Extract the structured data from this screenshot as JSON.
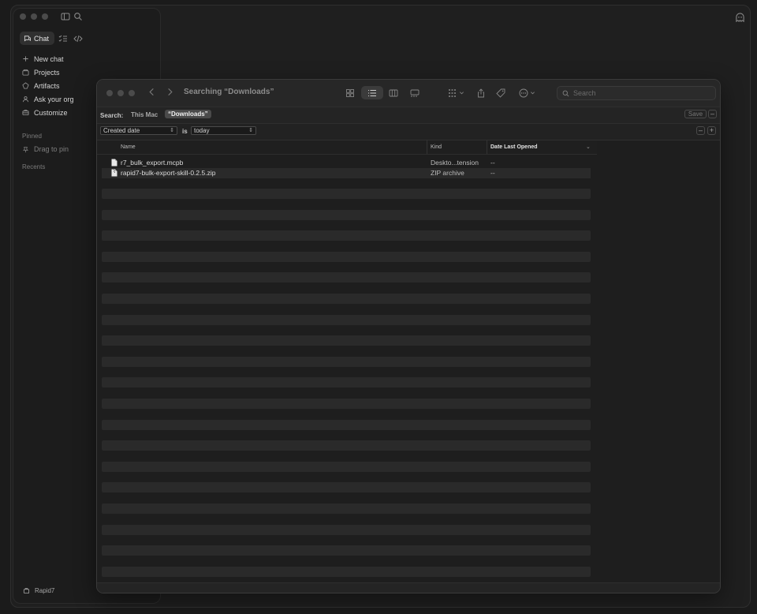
{
  "app": {
    "tabs": {
      "chat": "Chat"
    },
    "nav_items": [
      {
        "label": "New chat",
        "icon": "plus-icon"
      },
      {
        "label": "Projects",
        "icon": "folder-icon"
      },
      {
        "label": "Artifacts",
        "icon": "artifacts-icon"
      },
      {
        "label": "Ask your org",
        "icon": "org-icon"
      },
      {
        "label": "Customize",
        "icon": "briefcase-icon"
      }
    ],
    "pinned_label": "Pinned",
    "drag_to_pin": "Drag to pin",
    "recents_label": "Recents",
    "footer_user": "Rapid7"
  },
  "finder": {
    "title": "Searching “Downloads”",
    "search_placeholder": "Search",
    "scope": {
      "label": "Search:",
      "this_mac": "This Mac",
      "downloads": "“Downloads”",
      "save": "Save"
    },
    "criteria": {
      "attribute": "Created date",
      "operator": "is",
      "value": "today"
    },
    "columns": {
      "name": "Name",
      "kind": "Kind",
      "date": "Date Last Opened"
    },
    "files": [
      {
        "name": "r7_bulk_export.mcpb",
        "kind": "Deskto...tension",
        "date": "--"
      },
      {
        "name": "rapid7-bulk-export-skill-0.2.5.zip",
        "kind": "ZIP archive",
        "date": "--"
      }
    ]
  }
}
